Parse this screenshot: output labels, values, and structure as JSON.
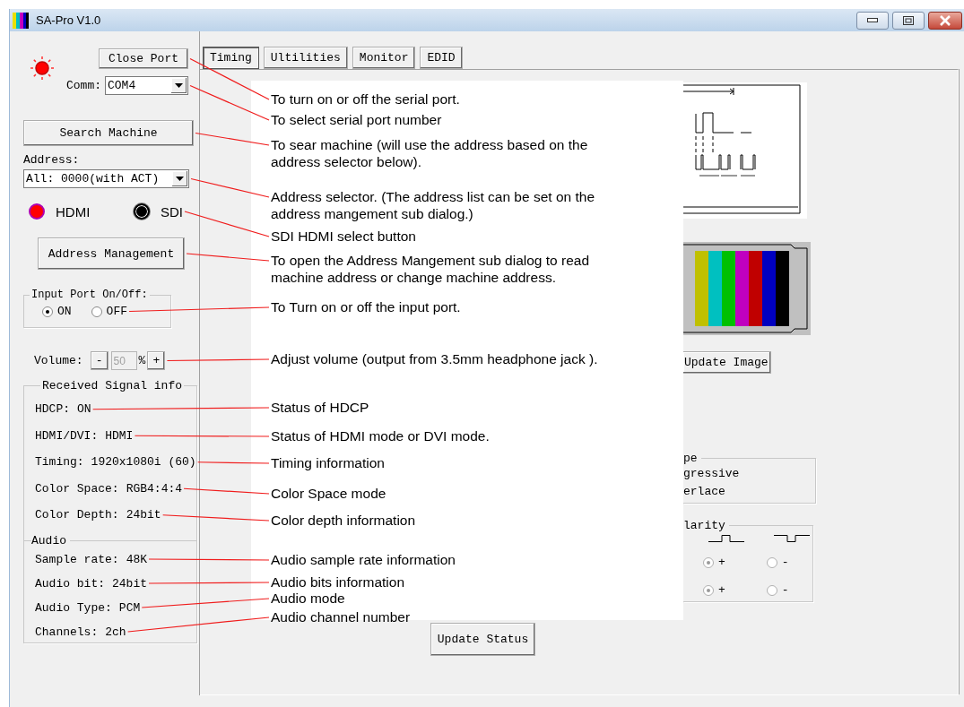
{
  "window": {
    "title": "SA-Pro V1.0"
  },
  "port": {
    "connected": true,
    "button": "Close Port",
    "comm_label": "Comm:",
    "comm_value": "COM4"
  },
  "search_button": "Search Machine",
  "address": {
    "label": "Address:",
    "value": "All: 0000(with ACT)"
  },
  "signal_select": [
    {
      "label": "HDMI",
      "selected": true
    },
    {
      "label": "SDI",
      "selected": false
    }
  ],
  "address_management_button": "Address Management",
  "input_port": {
    "title": "Input Port On/Off:",
    "options": [
      {
        "label": "ON",
        "selected": true
      },
      {
        "label": "OFF",
        "selected": false
      }
    ]
  },
  "volume": {
    "label": "Volume:",
    "decrease": "-",
    "value": "50",
    "unit": "%",
    "increase": "+",
    "disabled": true
  },
  "signal_info": {
    "title": "Received Signal info",
    "video": [
      {
        "label": "HDCP:",
        "value": "ON"
      },
      {
        "label": "HDMI/DVI:",
        "value": "HDMI"
      },
      {
        "label": "Timing:",
        "value": "1920x1080i (60)"
      },
      {
        "label": "Color Space:",
        "value": "RGB4:4:4"
      },
      {
        "label": "Color Depth:",
        "value": "24bit"
      }
    ],
    "audio_title": "Audio",
    "audio": [
      {
        "label": "Sample rate:",
        "value": "48K"
      },
      {
        "label": "Audio bit:",
        "value": "24bit"
      },
      {
        "label": "Audio Type:",
        "value": "PCM"
      },
      {
        "label": "Channels:",
        "value": "2ch"
      }
    ]
  },
  "tabs": [
    {
      "label": "Timing",
      "selected": true
    },
    {
      "label": "Ultilities",
      "selected": false
    },
    {
      "label": "Monitor",
      "selected": false
    },
    {
      "label": "EDID",
      "selected": false
    }
  ],
  "timing_panel": {
    "update_image_button": "Update Image",
    "scan_type": {
      "title": "pe",
      "options": [
        "gressive",
        "erlace"
      ]
    },
    "polarity": {
      "title": "larity",
      "disabled": true,
      "rows": [
        {
          "options": [
            {
              "label": "+",
              "selected": true
            },
            {
              "label": "-",
              "selected": false
            }
          ]
        },
        {
          "options": [
            {
              "label": "+",
              "selected": true
            },
            {
              "label": "-",
              "selected": false
            }
          ]
        }
      ]
    },
    "update_status_button": "Update Status"
  },
  "annotations": [
    {
      "text": "To turn on or off the serial port."
    },
    {
      "text": "To select serial port number"
    },
    {
      "text": "To sear machine (will use the address based on the address selector below)."
    },
    {
      "text": "Address selector. (The address list can be set on the address mangement sub dialog.)"
    },
    {
      "text": "SDI HDMI select button"
    },
    {
      "text": "To open the Address Mangement sub dialog to read machine address or change machine address."
    },
    {
      "text": "To Turn on or off the input port."
    },
    {
      "text": "Adjust volume (output from 3.5mm headphone jack )."
    },
    {
      "text": "Status of HDCP"
    },
    {
      "text": "Status of HDMI mode or DVI mode."
    },
    {
      "text": "Timing information"
    },
    {
      "text": "Color Space mode"
    },
    {
      "text": "Color depth information"
    },
    {
      "text": "Audio sample rate information"
    },
    {
      "text": "Audio bits information"
    },
    {
      "text": "Audio mode"
    },
    {
      "text": "Audio channel number"
    }
  ]
}
